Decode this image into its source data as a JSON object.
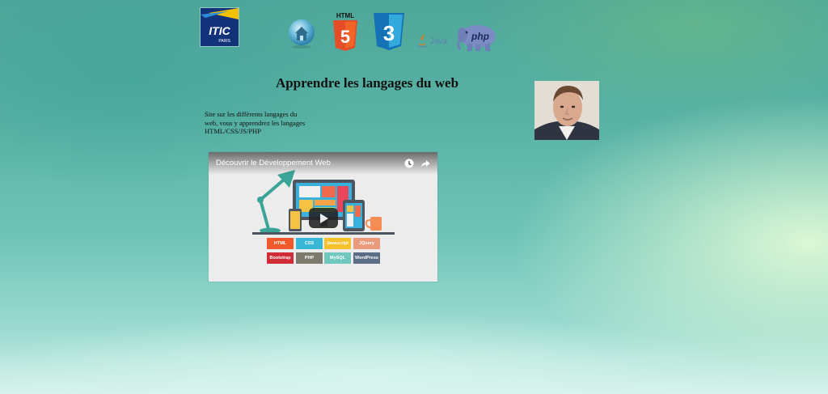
{
  "header": {
    "logo": {
      "main": "ITIC",
      "sub": "PARIS"
    },
    "nav_icons": [
      {
        "name": "home-icon"
      },
      {
        "name": "html5-icon",
        "label": "HTML",
        "number": "5"
      },
      {
        "name": "css3-icon",
        "number": "3"
      },
      {
        "name": "java-icon",
        "label": "Java"
      },
      {
        "name": "php-icon",
        "label": "php"
      }
    ]
  },
  "main": {
    "title": "Apprendre les langages du web",
    "intro": "Site sur les différents langages du web, vous y apprendrez les langages HTML/CSS/JS/PHP",
    "video": {
      "title": "Découvrir le Développement Web",
      "tags_row1": [
        "HTML",
        "CSS",
        "Javascript",
        "JQuery"
      ],
      "tags_row2": [
        "Bootstrap",
        "PHP",
        "MySQL",
        "WordPress"
      ]
    }
  },
  "colors": {
    "html5": "#e44d26",
    "css3": "#1572b6",
    "php": "#6f7fb8",
    "itic": "#12327a"
  }
}
